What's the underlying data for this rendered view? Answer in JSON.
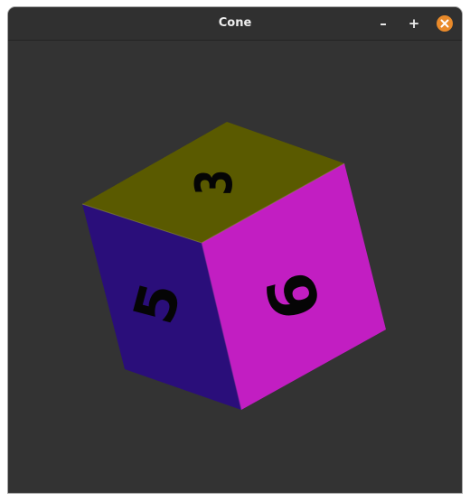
{
  "window": {
    "title": "Cone",
    "minimize_glyph": "–",
    "maximize_glyph": "+",
    "close_icon": "close-icon"
  },
  "scene": {
    "background": "#333333",
    "cube": {
      "top_face": {
        "color": "#5a5a00",
        "label": "3"
      },
      "left_face": {
        "color": "#2a0e7a",
        "label": "5"
      },
      "right_face": {
        "color": "#c21ec2",
        "label": "6"
      },
      "glyph_color": "#050505"
    }
  },
  "colors": {
    "titlebar": "#303030",
    "title_text": "#eeeeee",
    "close_button": "#e95420"
  }
}
